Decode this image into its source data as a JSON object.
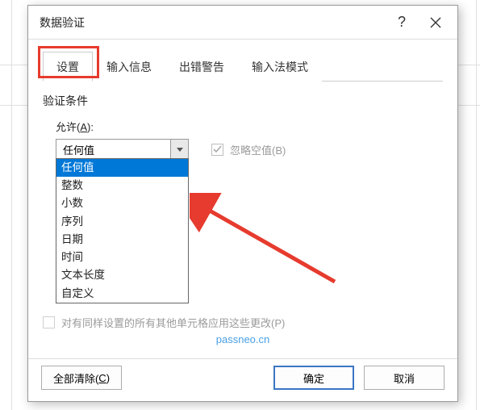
{
  "dialog": {
    "title": "数据验证",
    "help_tooltip": "?",
    "close_tooltip": "×"
  },
  "tabs": {
    "settings": "设置",
    "input_msg": "输入信息",
    "error_alert": "出错警告",
    "ime_mode": "输入法模式"
  },
  "content": {
    "criteria_label": "验证条件",
    "allow_label_prefix": "允许(",
    "allow_accel": "A",
    "allow_label_suffix": "):",
    "allow_value": "任何值",
    "ignore_blank_label": "忽略空值(B)"
  },
  "dropdown_items": {
    "0": "任何值",
    "1": "整数",
    "2": "小数",
    "3": "序列",
    "4": "日期",
    "5": "时间",
    "6": "文本长度",
    "7": "自定义"
  },
  "footer": {
    "apply_all_label": "对有同样设置的所有其他单元格应用这些更改(P)",
    "watermark": "passneo.cn",
    "clear_all": "全部清除(",
    "clear_all_accel": "C",
    "clear_all_suffix": ")",
    "ok": "确定",
    "cancel": "取消"
  }
}
